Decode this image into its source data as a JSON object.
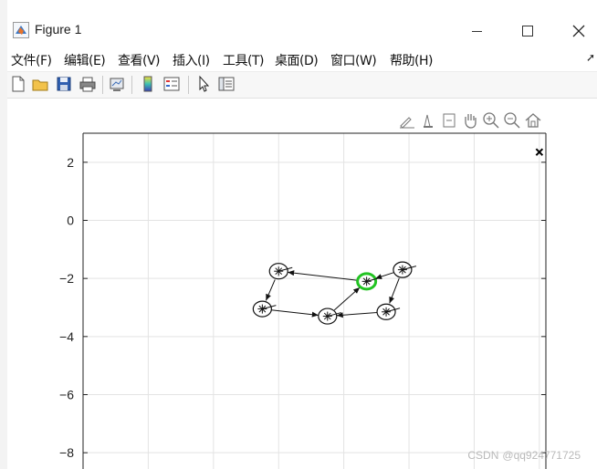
{
  "window": {
    "title": "Figure 1",
    "minimize_glyph": "—",
    "maximize_glyph": "☐",
    "close_glyph": "✕"
  },
  "menu": {
    "items": [
      {
        "label": "文件(F)"
      },
      {
        "label": "编辑(E)"
      },
      {
        "label": "查看(V)"
      },
      {
        "label": "插入(I)"
      },
      {
        "label": "工具(T)"
      },
      {
        "label": "桌面(D)"
      },
      {
        "label": "窗口(W)"
      },
      {
        "label": "帮助(H)"
      }
    ],
    "overflow_arrow": "➚"
  },
  "toolbar": {
    "icons": [
      "new-figure-icon",
      "open-folder-icon",
      "save-icon",
      "print-icon",
      "link-plot-icon",
      "colorbar-icon",
      "legend-icon",
      "pointer-icon",
      "property-inspector-icon"
    ]
  },
  "axes_toolbar": {
    "icons": [
      "brush-icon",
      "data-tips-icon",
      "datatip-list-icon",
      "pan-icon",
      "zoom-in-icon",
      "zoom-out-icon",
      "home-icon"
    ]
  },
  "chart_data": {
    "type": "scatter",
    "yticks": [
      2,
      0,
      -2,
      -4,
      -6,
      -8
    ],
    "ylim": [
      -9,
      3
    ],
    "xlim": [
      -4,
      10.2
    ],
    "grid": true,
    "nodes": [
      {
        "x": 2.0,
        "y": -1.75
      },
      {
        "x": 1.5,
        "y": -3.05
      },
      {
        "x": 3.5,
        "y": -3.3
      },
      {
        "x": 4.7,
        "y": -2.1,
        "highlight": true
      },
      {
        "x": 5.8,
        "y": -1.7
      },
      {
        "x": 5.3,
        "y": -3.15
      }
    ],
    "edges": [
      {
        "from": 3,
        "to": 0
      },
      {
        "from": 0,
        "to": 1
      },
      {
        "from": 1,
        "to": 2
      },
      {
        "from": 2,
        "to": 3
      },
      {
        "from": 4,
        "to": 3
      },
      {
        "from": 4,
        "to": 5
      },
      {
        "from": 5,
        "to": 2
      }
    ],
    "extra_marker": {
      "x": 10,
      "y": 2.35
    },
    "colors": {
      "highlight": "#22c322",
      "ink": "#111111",
      "grid": "#e3e3e3"
    }
  },
  "watermark": {
    "site": "CSDN",
    "handle": "@qq924771725"
  }
}
